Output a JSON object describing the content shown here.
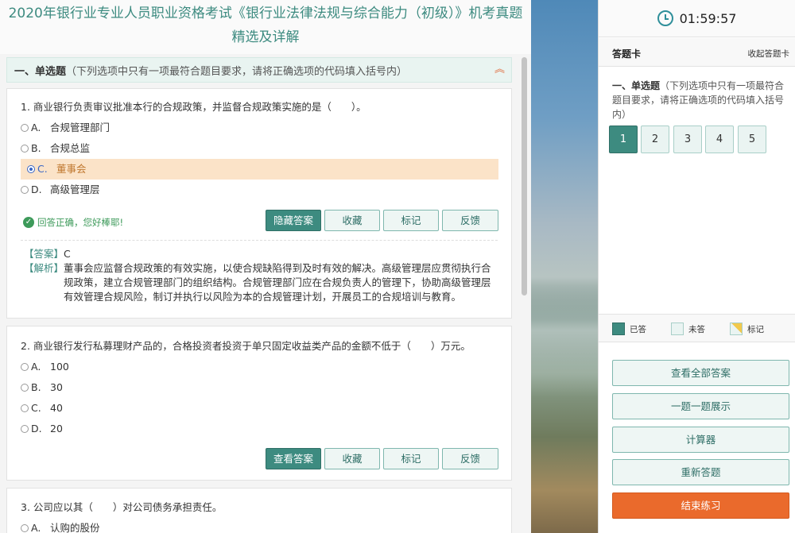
{
  "page": {
    "title_line1": "2020年银行业专业人员职业资格考试《银行业法律法规与综合能力（初级）》机考真题",
    "title_line2": "精选及详解"
  },
  "section": {
    "name": "一、单选题",
    "desc": "（下列选项中只有一项最符合题目要求，请将正确选项的代码填入括号内）"
  },
  "questions": [
    {
      "text": "1. 商业银行负责审议批准本行的合规政策，并监督合规政策实施的是（　　）。",
      "options": [
        {
          "letter": "A.",
          "text": "合规管理部门"
        },
        {
          "letter": "B.",
          "text": "合规总监"
        },
        {
          "letter": "C.",
          "text": "董事会"
        },
        {
          "letter": "D.",
          "text": "高级管理层"
        }
      ],
      "selected": "C",
      "feedback": "回答正确，您好棒耶!",
      "buttons": {
        "toggle": "隐藏答案",
        "fav": "收藏",
        "mark": "标记",
        "report": "反馈"
      },
      "answer_tag": "【答案】",
      "answer": "C",
      "analysis_tag": "【解析】",
      "analysis": "董事会应监督合规政策的有效实施，以使合规缺陷得到及时有效的解决。高级管理层应贯彻执行合规政策，建立合规管理部门的组织结构。合规管理部门应在合规负责人的管理下，协助高级管理层有效管理合规风险，制订并执行以风险为本的合规管理计划，开展员工的合规培训与教育。"
    },
    {
      "text": "2. 商业银行发行私募理财产品的，合格投资者投资于单只固定收益类产品的金额不低于（　　）万元。",
      "options": [
        {
          "letter": "A.",
          "text": "100"
        },
        {
          "letter": "B.",
          "text": "30"
        },
        {
          "letter": "C.",
          "text": "40"
        },
        {
          "letter": "D.",
          "text": "20"
        }
      ],
      "buttons": {
        "toggle": "查看答案",
        "fav": "收藏",
        "mark": "标记",
        "report": "反馈"
      }
    },
    {
      "text": "3. 公司应以其（　　）对公司债务承担责任。",
      "options": [
        {
          "letter": "A.",
          "text": "认购的股份"
        }
      ]
    }
  ],
  "panel": {
    "timer": "01:59:57",
    "card_title": "答题卡",
    "collapse_label": "收起答题卡",
    "section_name": "一、单选题",
    "section_desc": "（下列选项中只有一项最符合题目要求，请将正确选项的代码填入括号内）",
    "numbers": [
      "1",
      "2",
      "3",
      "4",
      "5"
    ],
    "answered": [
      1
    ],
    "legend": {
      "done": "已答",
      "todo": "未答",
      "mark": "标记"
    },
    "buttons": {
      "view_all": "查看全部答案",
      "one_by_one": "一题一题展示",
      "calculator": "计算器",
      "restart": "重新答题",
      "end": "结束练习"
    }
  },
  "colors": {
    "accent": "#3d8b80",
    "selected_bg": "#fbe3c8",
    "end_button": "#ea6a2c",
    "correct": "#3d9a5a"
  }
}
